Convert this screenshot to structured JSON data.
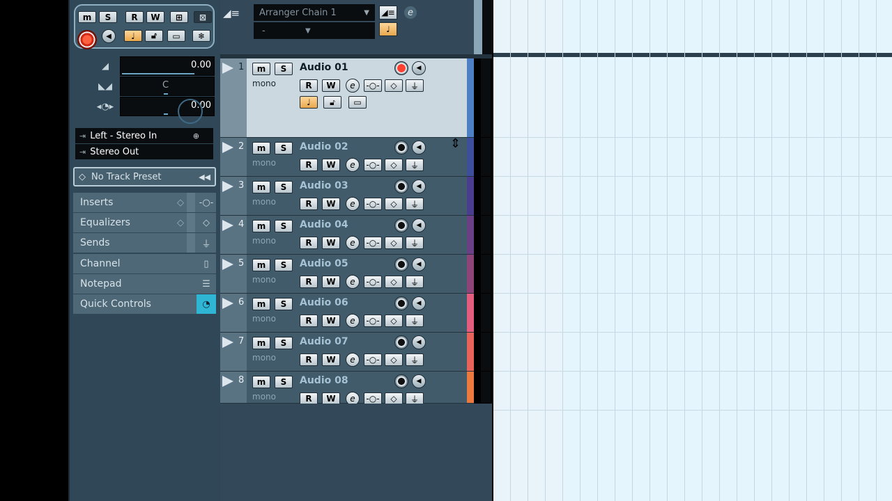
{
  "inspector": {
    "top_buttons": [
      "m",
      "S",
      "R",
      "W",
      "⊞",
      "⊠"
    ],
    "volume": "0.00",
    "pan": "C",
    "delay": "0.00",
    "input_routing": "Left - Stereo In",
    "output_routing": "Stereo Out",
    "preset": "No Track Preset",
    "sections": [
      {
        "label": "Inserts"
      },
      {
        "label": "Equalizers"
      },
      {
        "label": "Sends"
      },
      {
        "label": "Channel"
      },
      {
        "label": "Notepad"
      },
      {
        "label": "Quick Controls"
      }
    ]
  },
  "header": {
    "arranger_chain": "Arranger Chain 1",
    "arranger_sub": "-",
    "e_label": "e"
  },
  "tracks": [
    {
      "num": "1",
      "name": "Audio 01",
      "type": "mono",
      "color": "#4d7fc4",
      "selected": true
    },
    {
      "num": "2",
      "name": "Audio 02",
      "type": "mono",
      "color": "#3d4f9a"
    },
    {
      "num": "3",
      "name": "Audio 03",
      "type": "mono",
      "color": "#4a3d8f"
    },
    {
      "num": "4",
      "name": "Audio 04",
      "type": "mono",
      "color": "#6a3f86"
    },
    {
      "num": "5",
      "name": "Audio 05",
      "type": "mono",
      "color": "#8e4478"
    },
    {
      "num": "6",
      "name": "Audio 06",
      "type": "mono",
      "color": "#e45d7f"
    },
    {
      "num": "7",
      "name": "Audio 07",
      "type": "mono",
      "color": "#e8645a"
    },
    {
      "num": "8",
      "name": "Audio 08",
      "type": "mono",
      "color": "#ec7a3e"
    }
  ],
  "track_buttons": {
    "mute": "m",
    "solo": "S",
    "read": "R",
    "write": "W",
    "edit": "e"
  }
}
